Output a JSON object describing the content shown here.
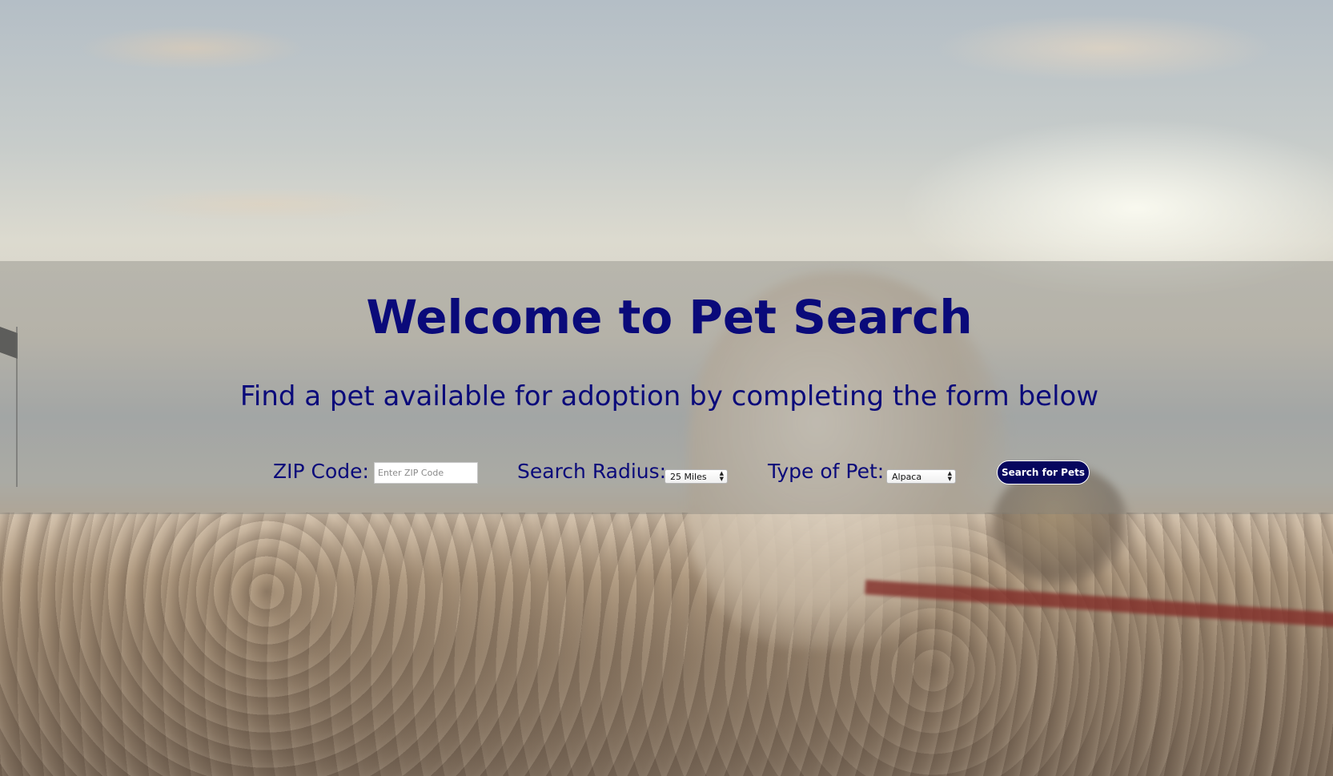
{
  "page": {
    "title": "Welcome to Pet Search",
    "subtitle": "Find a pet available for adoption by completing the form below"
  },
  "form": {
    "zip": {
      "label": "ZIP Code:",
      "value": "",
      "placeholder": "Enter ZIP Code"
    },
    "radius": {
      "label": "Search Radius:",
      "selected": "25 Miles"
    },
    "pet_type": {
      "label": "Type of Pet:",
      "selected": "Alpaca"
    },
    "submit_label": "Search for Pets"
  },
  "colors": {
    "heading_text": "#0a0a7a",
    "button_bg": "#07075e",
    "button_text": "#ffffff"
  },
  "icons": {
    "select_arrow": "updown-arrows-icon"
  }
}
